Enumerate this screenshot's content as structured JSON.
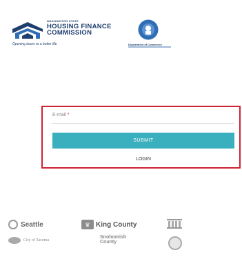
{
  "header": {
    "hfc": {
      "small_text": "WASHINGTON STATE",
      "name_line1": "HOUSING FINANCE",
      "name_line2": "COMMISSION",
      "tagline": "Opening doors to a better life"
    },
    "commerce": {
      "seal_text": "STATE OF WASHINGTON",
      "name": "Department of Commerce"
    }
  },
  "form": {
    "email_label": "E-mail",
    "required_mark": "*",
    "email_value": "",
    "submit_label": "SUBMIT",
    "login_label": "LOGIN",
    "highlight_color": "#cc2233",
    "button_color": "#3aafbd"
  },
  "partners": {
    "seattle": "Seattle",
    "king_county": "King County",
    "tacoma": "City of Tacoma",
    "snohomish_line1": "Snohomish",
    "snohomish_line2": "County"
  }
}
